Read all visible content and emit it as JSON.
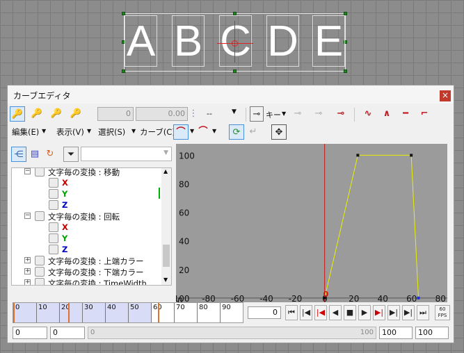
{
  "viewport": {
    "letters": [
      "A",
      "B",
      "C",
      "D",
      "E"
    ]
  },
  "window": {
    "title": "カーブエディタ",
    "close_glyph": "×"
  },
  "toolbar": {
    "value1": "0",
    "value2": "0.00",
    "interp_select": "--",
    "key_label": "キー"
  },
  "menu": {
    "edit": "編集(E)",
    "view": "表示(V)",
    "select": "選択(S)",
    "curve": "カーブ(C)"
  },
  "tree": {
    "rows": [
      {
        "label": "文字毎の変換 : 移動",
        "kind": "group"
      },
      {
        "label": "X",
        "kind": "axis",
        "color": "#c00000"
      },
      {
        "label": "Y",
        "kind": "axis",
        "color": "#00a000"
      },
      {
        "label": "Z",
        "kind": "axis",
        "color": "#0000c0"
      },
      {
        "label": "文字毎の変換 : 回転",
        "kind": "group"
      },
      {
        "label": "X",
        "kind": "axis",
        "color": "#c00000"
      },
      {
        "label": "Y",
        "kind": "axis",
        "color": "#00a000"
      },
      {
        "label": "Z",
        "kind": "axis",
        "color": "#0000c0"
      },
      {
        "label": "文字毎の変換 : 上端カラー",
        "kind": "group"
      },
      {
        "label": "文字毎の変換 : 下端カラー",
        "kind": "group"
      },
      {
        "label": "文字毎の変換 : TimeWidth",
        "kind": "group"
      }
    ]
  },
  "graph": {
    "y_ticks": [
      "100",
      "80",
      "60",
      "40",
      "20"
    ],
    "x_ticks": [
      "-100",
      "-80",
      "-60",
      "-40",
      "-20",
      "0",
      "20",
      "40",
      "60",
      "80"
    ],
    "y_origin_label": "0",
    "key_marker_label": "0",
    "curve_color": "#e8f000",
    "cursor_color": "#d01010"
  },
  "chart_data": {
    "type": "line",
    "series": [
      {
        "x": [
          0,
          23,
          60,
          65
        ],
        "y": [
          0,
          100,
          100,
          0
        ]
      }
    ],
    "xlim": [
      -103,
      85
    ],
    "ylim": [
      -3,
      108
    ]
  },
  "timeline": {
    "ticks": [
      "0",
      "10",
      "20",
      "30",
      "40",
      "50",
      "60",
      "70",
      "80",
      "90"
    ],
    "range_end": 60
  },
  "playback": {
    "current_frame": "0",
    "fps_label": "60 FPS",
    "range_start": "0",
    "range_start2": "0",
    "slider_min": "0",
    "slider_max": "100",
    "end_frame": "100",
    "end_frame2": "100"
  }
}
